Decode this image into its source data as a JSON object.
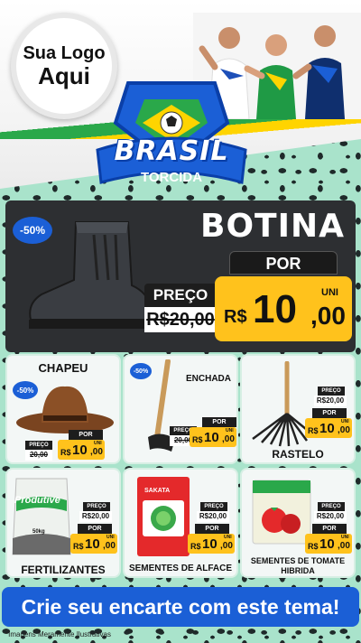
{
  "colors": {
    "accent_blue": "#1b5fd6",
    "price_yellow": "#ffc21c",
    "dark_panel": "#2d2f32",
    "pattern_mint": "#a9e3cb",
    "brand_green": "#2aa84a"
  },
  "header": {
    "logo_line1": "Sua Logo",
    "logo_line2": "Aqui",
    "badge_title": "BRASIL",
    "badge_subtitle": "TORCIDA"
  },
  "featured": {
    "name": "BOTINA",
    "discount": "-50%",
    "por_label": "POR",
    "preco_label": "PREÇO",
    "old_price": "R$20,00",
    "currency": "R$",
    "price_int": "10",
    "price_dec": ",00",
    "unit": "UNI"
  },
  "products": [
    {
      "name": "CHAPEU",
      "discount": "-50%",
      "preco_label": "PREÇO",
      "old_price": "20,00",
      "por_label": "POR",
      "currency": "R$",
      "price_int": "10",
      "price_dec": ",00",
      "unit": "UNI"
    },
    {
      "name": "ENCHADA",
      "discount": "-50%",
      "preco_label": "PREÇO",
      "old_price": "20,00",
      "por_label": "POR",
      "currency": "R$",
      "price_int": "10",
      "price_dec": ",00",
      "unit": "UNI"
    },
    {
      "name": "RASTELO",
      "preco_label": "PREÇO",
      "old_price": "R$20,00",
      "por_label": "POR",
      "currency": "R$",
      "price_int": "10",
      "price_dec": ",00",
      "unit": "UNI"
    },
    {
      "name": "FERTILIZANTES",
      "pack_brand": "Produtive",
      "pack_weight": "50kg",
      "preco_label": "PREÇO",
      "old_price": "R$20,00",
      "por_label": "POR",
      "currency": "R$",
      "price_int": "10",
      "price_dec": ",00",
      "unit": "UNI"
    },
    {
      "name": "SEMENTES DE ALFACE",
      "pack_brand": "SAKATA",
      "preco_label": "PREÇO",
      "old_price": "R$20,00",
      "por_label": "POR",
      "currency": "R$",
      "price_int": "10",
      "price_dec": ",00",
      "unit": "UNI"
    },
    {
      "name": "SEMENTES DE TOMATE HIBRIDA",
      "preco_label": "PREÇO",
      "old_price": "R$20,00",
      "por_label": "POR",
      "currency": "R$",
      "price_int": "10",
      "price_dec": ",00",
      "unit": "UNI"
    }
  ],
  "footer": {
    "cta": "Crie seu encarte com este tema!",
    "disclaimer": "*Imagens Meramente Ilustrativas"
  }
}
